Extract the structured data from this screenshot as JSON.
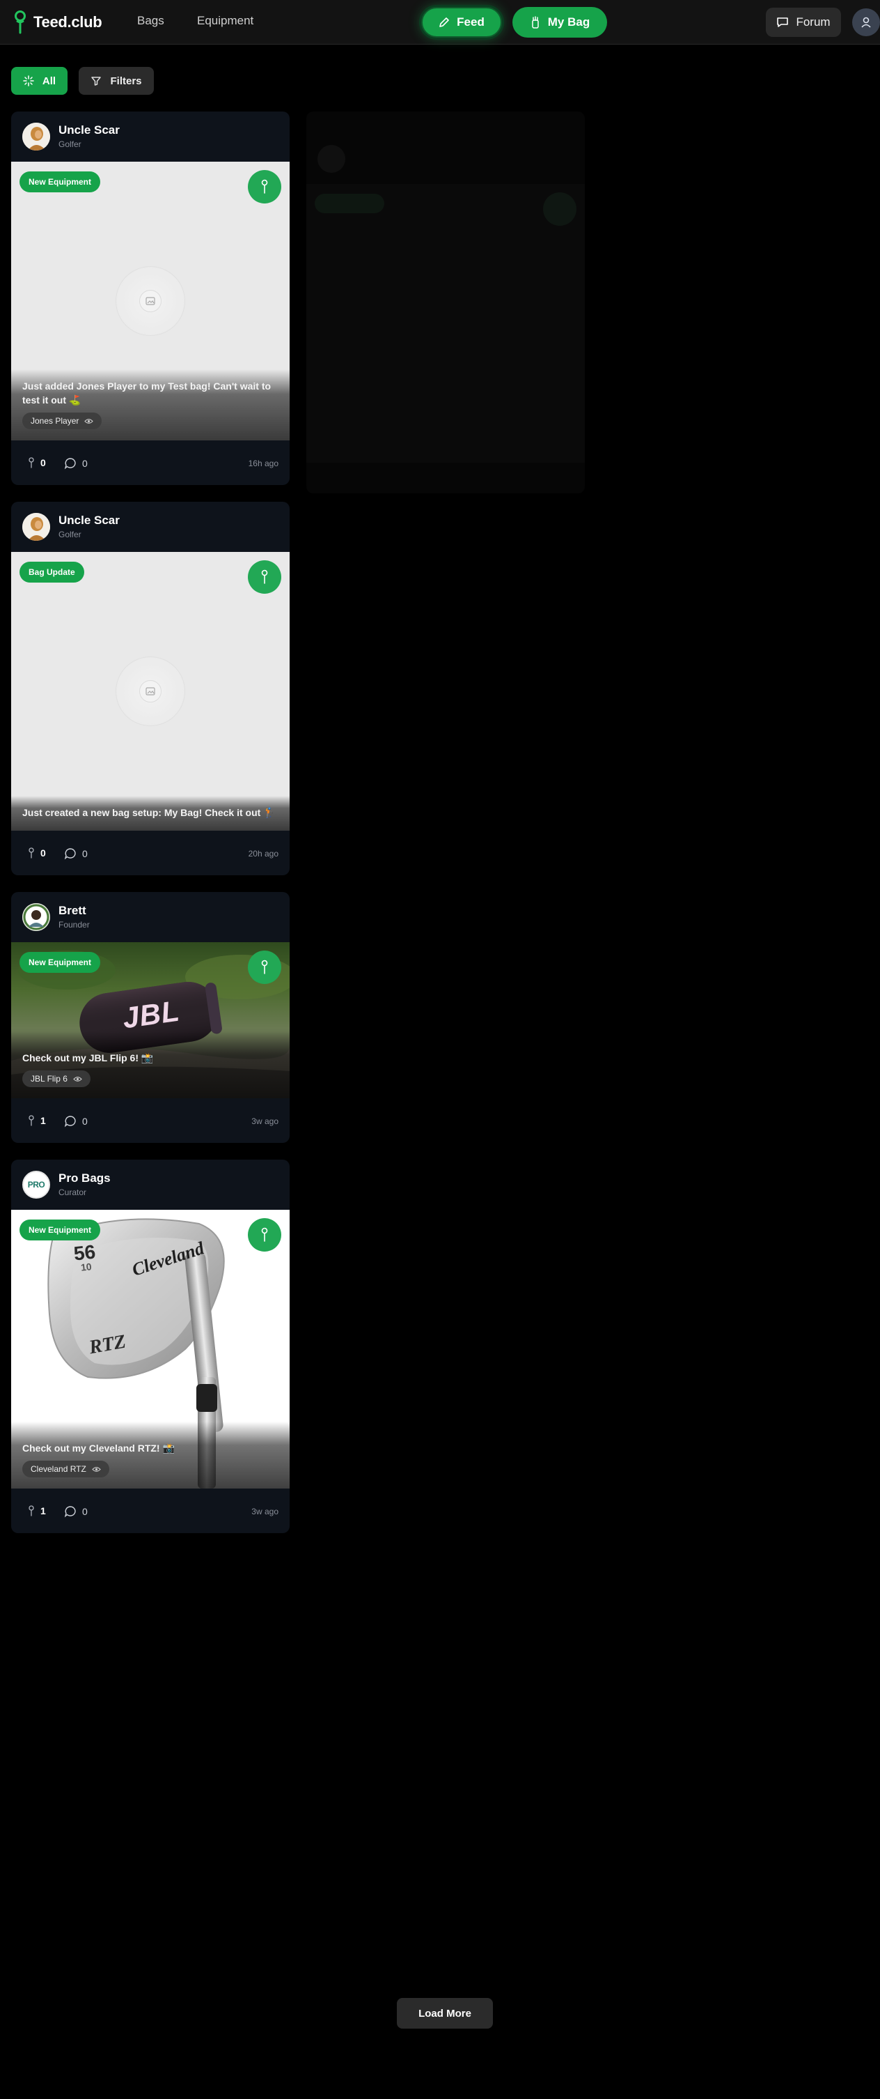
{
  "header": {
    "logo_text": "Teed.club",
    "nav": [
      "Bags",
      "Equipment"
    ],
    "feed_label": "Feed",
    "mybag_label": "My Bag",
    "forum_label": "Forum"
  },
  "filters": {
    "all_label": "All",
    "filters_label": "Filters"
  },
  "posts": [
    {
      "user": "Uncle Scar",
      "role": "Golfer",
      "badge": "New Equipment",
      "caption": "Just added Jones Player to my Test bag! Can't wait to test it out ⛳",
      "tag": "Jones Player",
      "tees": "0",
      "comments": "0",
      "time": "16h ago"
    },
    {
      "user": "Uncle Scar",
      "role": "Golfer",
      "badge": "Bag Update",
      "caption": "Just created a new bag setup: My Bag! Check it out 🏌",
      "tees": "0",
      "comments": "0",
      "time": "20h ago"
    },
    {
      "user": "Brett",
      "role": "Founder",
      "badge": "New Equipment",
      "caption": "Check out my JBL Flip 6! 📸",
      "tag": "JBL Flip 6",
      "product_text": "JBL",
      "tees": "1",
      "comments": "0",
      "time": "3w ago"
    },
    {
      "user": "Pro Bags",
      "role": "Curator",
      "avatar_text": "PRO",
      "badge": "New Equipment",
      "caption": "Check out my Cleveland RTZ! 📸",
      "tag": "Cleveland RTZ",
      "product_loft": "56",
      "product_bounce": "10",
      "product_brand": "Cleveland",
      "product_model": "RTZ",
      "tees": "1",
      "comments": "0",
      "time": "3w ago"
    }
  ],
  "load_more_label": "Load More",
  "colors": {
    "accent": "#16a34a",
    "background": "#000000",
    "card": "#0e131b",
    "header": "#131313"
  }
}
